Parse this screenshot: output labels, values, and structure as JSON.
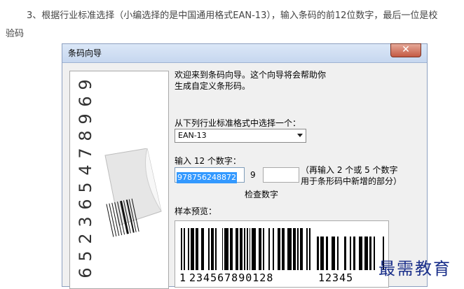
{
  "article": {
    "line1": "3、根据行业标准选择（小编选择的是中国通用格式EAN-13），输入条码的前12位数字，最后一位是校",
    "line2": "验码"
  },
  "dialog": {
    "title": "条码向导",
    "close_label": "✕",
    "intro_line1": "欢迎来到条码向导。这个向导将会帮助你",
    "intro_line2": "生成自定义条形码。",
    "standard_label": "从下列行业标准格式中选择一个：",
    "standard_value": "EAN-13",
    "digits_label": "输入 12 个数字：",
    "digits_value": "978756248872",
    "check_digit": "9",
    "extra_note_line1": "（再输入 2 个或 5 个数字",
    "extra_note_line2": "用于条形码中新增的部分）",
    "check_label": "检查数字",
    "preview_label": "样本预览：",
    "preview_first_digit": "1",
    "preview_main_digits": "234567890128",
    "preview_addon_digits": "12345",
    "side_digits": [
      "6",
      "5",
      "2",
      "3",
      "6",
      "5",
      "4",
      "7",
      "8",
      "9",
      "6",
      "9"
    ]
  },
  "watermark": "最需教育",
  "icons": {
    "close": "close-icon",
    "dropdown": "chevron-down-icon"
  },
  "colors": {
    "selection": "#3399ff",
    "watermark": "#1a2f8a",
    "close": "#c45a43"
  }
}
